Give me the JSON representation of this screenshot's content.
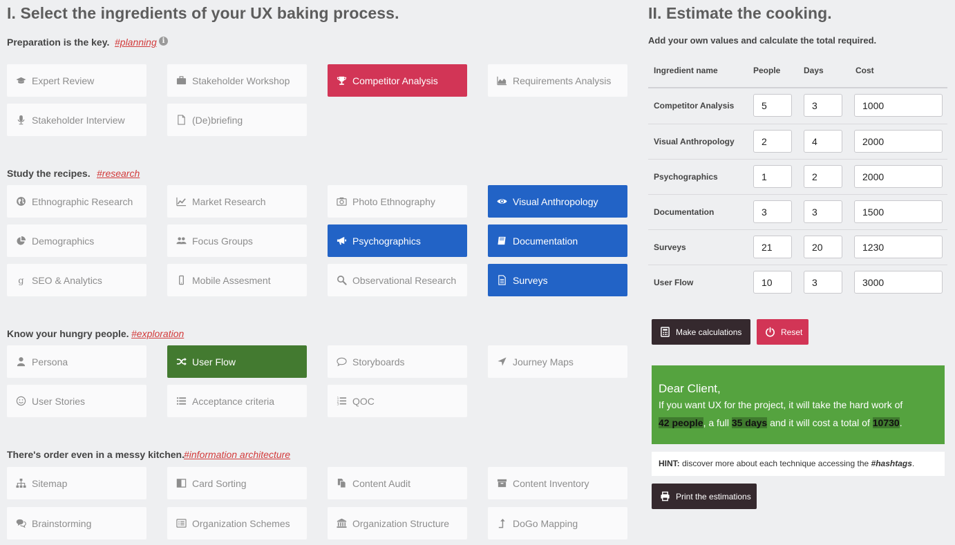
{
  "left": {
    "title": "I. Select the ingredients of your UX baking process.",
    "sections": [
      {
        "label": "Preparation is the key.",
        "tag": "#planning",
        "has_info": true,
        "items": [
          {
            "label": "Expert Review",
            "icon": "graduation-cap-icon",
            "state": "off"
          },
          {
            "label": "Stakeholder Workshop",
            "icon": "briefcase-icon",
            "state": "off"
          },
          {
            "label": "Competitor Analysis",
            "icon": "trophy-icon",
            "state": "red"
          },
          {
            "label": "Requirements Analysis",
            "icon": "area-chart-icon",
            "state": "off"
          },
          {
            "label": "Stakeholder Interview",
            "icon": "microphone-icon",
            "state": "off"
          },
          {
            "label": "(De)briefing",
            "icon": "file-icon",
            "state": "off"
          }
        ]
      },
      {
        "label": "Study the recipes.",
        "tag": "#research",
        "items": [
          {
            "label": "Ethnographic Research",
            "icon": "globe-icon",
            "state": "off"
          },
          {
            "label": "Market Research",
            "icon": "line-chart-icon",
            "state": "off"
          },
          {
            "label": "Photo Ethnography",
            "icon": "camera-icon",
            "state": "off"
          },
          {
            "label": "Visual Anthropology",
            "icon": "eye-icon",
            "state": "blue"
          },
          {
            "label": "Demographics",
            "icon": "pie-chart-icon",
            "state": "off"
          },
          {
            "label": "Focus Groups",
            "icon": "users-icon",
            "state": "off"
          },
          {
            "label": "Psychographics",
            "icon": "bullhorn-icon",
            "state": "blue"
          },
          {
            "label": "Documentation",
            "icon": "book-icon",
            "state": "blue"
          },
          {
            "label": "SEO & Analytics",
            "icon": "google-icon",
            "state": "off"
          },
          {
            "label": "Mobile Assesment",
            "icon": "mobile-icon",
            "state": "off"
          },
          {
            "label": "Observational Research",
            "icon": "search-icon",
            "state": "off"
          },
          {
            "label": "Surveys",
            "icon": "file-text-icon",
            "state": "blue"
          }
        ]
      },
      {
        "label": "Know your hungry people.",
        "tag": "#exploration",
        "items": [
          {
            "label": "Persona",
            "icon": "user-icon",
            "state": "off"
          },
          {
            "label": "User Flow",
            "icon": "random-icon",
            "state": "green"
          },
          {
            "label": "Storyboards",
            "icon": "comment-icon",
            "state": "off"
          },
          {
            "label": "Journey Maps",
            "icon": "location-arrow-icon",
            "state": "off"
          },
          {
            "label": "User Stories",
            "icon": "smile-icon",
            "state": "off"
          },
          {
            "label": "Acceptance criteria",
            "icon": "list-icon",
            "state": "off"
          },
          {
            "label": "QOC",
            "icon": "list-ol-icon",
            "state": "off"
          }
        ]
      },
      {
        "label": "There's order even in a messy kitchen.",
        "tag": "#information architecture",
        "items": [
          {
            "label": "Sitemap",
            "icon": "sitemap-icon",
            "state": "off"
          },
          {
            "label": "Card Sorting",
            "icon": "columns-icon",
            "state": "off"
          },
          {
            "label": "Content Audit",
            "icon": "copy-icon",
            "state": "off"
          },
          {
            "label": "Content Inventory",
            "icon": "archive-icon",
            "state": "off"
          },
          {
            "label": "Brainstorming",
            "icon": "comments-icon",
            "state": "off"
          },
          {
            "label": "Organization Schemes",
            "icon": "list-alt-icon",
            "state": "off"
          },
          {
            "label": "Organization Structure",
            "icon": "bank-icon",
            "state": "off"
          },
          {
            "label": "DoGo Mapping",
            "icon": "level-up-icon",
            "state": "off"
          }
        ]
      }
    ]
  },
  "right": {
    "title": "II. Estimate the cooking.",
    "subtitle": "Add your own values and calculate the total required.",
    "table": {
      "headers": [
        "Ingredient name",
        "People",
        "Days",
        "Cost"
      ],
      "rows": [
        {
          "name": "Competitor Analysis",
          "people": "5",
          "days": "3",
          "cost": "1000"
        },
        {
          "name": "Visual Anthropology",
          "people": "2",
          "days": "4",
          "cost": "2000"
        },
        {
          "name": "Psychographics",
          "people": "1",
          "days": "2",
          "cost": "2000"
        },
        {
          "name": "Documentation",
          "people": "3",
          "days": "3",
          "cost": "1500"
        },
        {
          "name": "Surveys",
          "people": "21",
          "days": "20",
          "cost": "1230"
        },
        {
          "name": "User Flow",
          "people": "10",
          "days": "3",
          "cost": "3000"
        }
      ]
    },
    "buttons": {
      "calculate": "Make calculations",
      "reset": "Reset",
      "print": "Print the estimations"
    },
    "result": {
      "greeting": "Dear Client,",
      "line1": "If you want UX for the project, it will take the hard work of",
      "people": "42 people",
      "mid1": ", a full ",
      "days": "35 days",
      "mid2": " and it will cost a total of ",
      "cost": "10730",
      "end": "."
    },
    "hint": {
      "label": "HINT:",
      "text_before": " discover more about each technique accessing the ",
      "emph": "#hashtags",
      "text_after": "."
    }
  },
  "colors": {
    "selected_red": "#d23556",
    "selected_blue": "#2263c6",
    "selected_green": "#437a30",
    "result_green": "#55a33f",
    "dark_button": "#35292e",
    "tag_red": "#d23a3a"
  }
}
